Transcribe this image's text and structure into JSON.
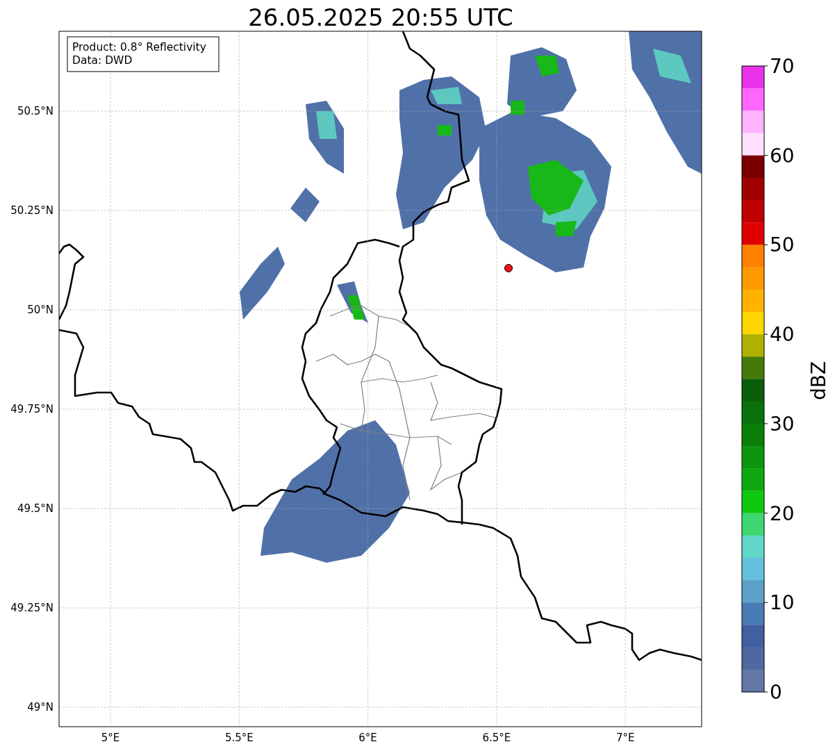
{
  "title": "26.05.2025 20:55 UTC",
  "legend": [
    "Product: 0.8° Reflectivity",
    "Data: DWD"
  ],
  "map": {
    "x_tick_labels": [
      "5°E",
      "5.5°E",
      "6°E",
      "6.5°E",
      "7°E"
    ],
    "y_tick_labels": [
      "50.5°N",
      "50.25°N",
      "50°N",
      "49.75°N",
      "49.5°N",
      "49.25°N",
      "49°N"
    ]
  },
  "colorbar": {
    "label": "dBZ",
    "tick_labels": [
      "70",
      "60",
      "50",
      "40",
      "30",
      "20",
      "10",
      "0"
    ],
    "segments": [
      {
        "color": "#e833e8"
      },
      {
        "color": "#ff66ff"
      },
      {
        "color": "#ffb3ff"
      },
      {
        "color": "#ffe0ff"
      },
      {
        "color": "#7a0000"
      },
      {
        "color": "#a00000"
      },
      {
        "color": "#c00000"
      },
      {
        "color": "#e00000"
      },
      {
        "color": "#ff8000"
      },
      {
        "color": "#ff9900"
      },
      {
        "color": "#ffb300"
      },
      {
        "color": "#ffd700"
      },
      {
        "color": "#b0b000"
      },
      {
        "color": "#457a0a"
      },
      {
        "color": "#0a5e0a"
      },
      {
        "color": "#0a700a"
      },
      {
        "color": "#0a800a"
      },
      {
        "color": "#0e950e"
      },
      {
        "color": "#10a810"
      },
      {
        "color": "#10c810"
      },
      {
        "color": "#3dd670"
      },
      {
        "color": "#60d8c8"
      },
      {
        "color": "#66c0dc"
      },
      {
        "color": "#5aa0c8"
      },
      {
        "color": "#4a7ab4"
      },
      {
        "color": "#4060a0"
      },
      {
        "color": "#5068a0"
      },
      {
        "color": "#6478a8"
      }
    ]
  }
}
